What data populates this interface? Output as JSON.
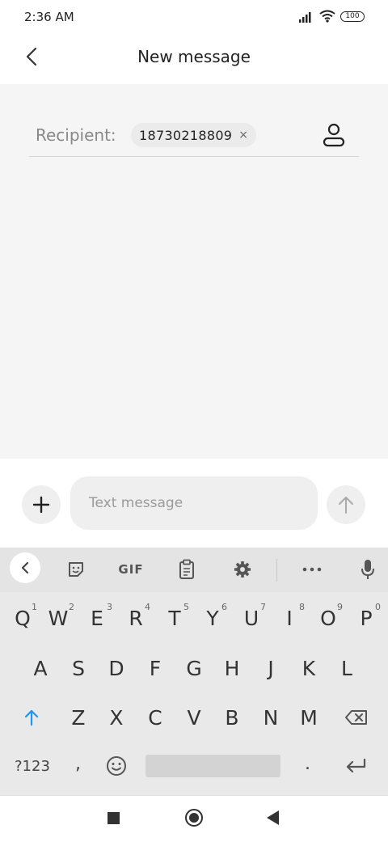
{
  "status_bar": {
    "time": "2:36 AM",
    "battery": "100",
    "icons": [
      "signal-icon",
      "wifi-icon",
      "battery-icon"
    ]
  },
  "header": {
    "title": "New message",
    "back_icon": "back-chevron-icon"
  },
  "recipient": {
    "label": "Recipient:",
    "chip_value": "18730218809",
    "chip_remove": "×",
    "contact_icon": "person-icon"
  },
  "compose": {
    "placeholder": "Text message",
    "add_icon": "plus-icon",
    "send_icon": "arrow-up-icon"
  },
  "keyboard": {
    "toolbar": [
      "collapse-icon",
      "sticker-icon",
      "GIF",
      "clipboard-icon",
      "gear-icon",
      "more-icon",
      "mic-icon"
    ],
    "gif_label": "GIF",
    "row1": [
      "Q",
      "W",
      "E",
      "R",
      "T",
      "Y",
      "U",
      "I",
      "O",
      "P"
    ],
    "row1_numbers": [
      "1",
      "2",
      "3",
      "4",
      "5",
      "6",
      "7",
      "8",
      "9",
      "0"
    ],
    "row2": [
      "A",
      "S",
      "D",
      "F",
      "G",
      "H",
      "J",
      "K",
      "L"
    ],
    "row3": [
      "Z",
      "X",
      "C",
      "V",
      "B",
      "N",
      "M"
    ],
    "shift_icon": "shift-arrow-icon",
    "backspace_icon": "backspace-icon",
    "mode_label": "?123",
    "comma": ",",
    "emoji_icon": "emoji-icon",
    "period": ".",
    "enter_icon": "enter-icon",
    "accent_color": "#2196f3"
  },
  "nav_bar": {
    "icons": [
      "recents-square-icon",
      "home-circle-icon",
      "back-triangle-icon"
    ]
  }
}
